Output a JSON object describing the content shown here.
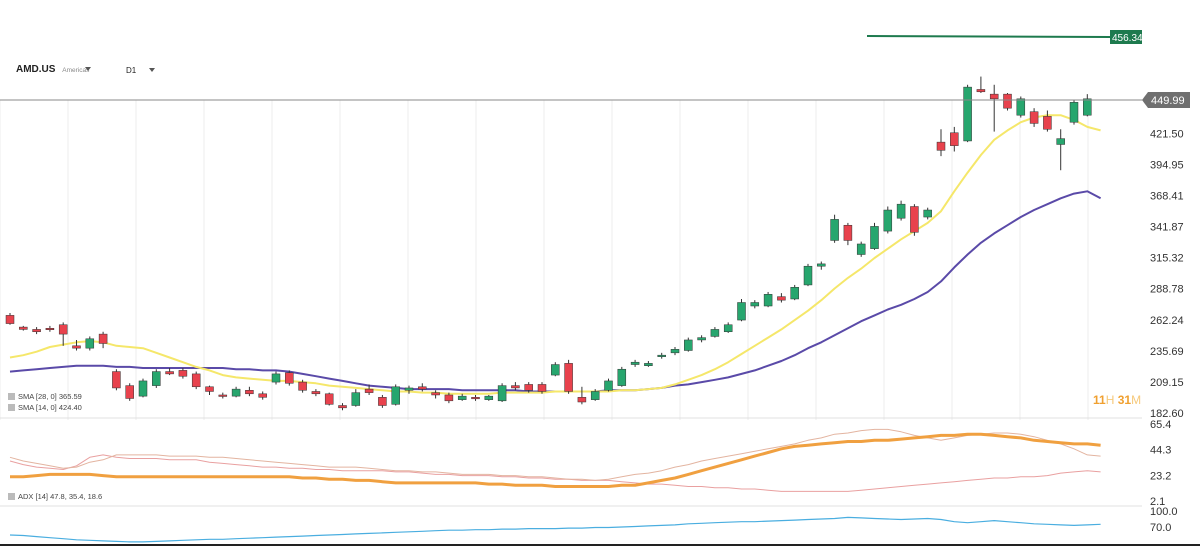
{
  "toolbar": {
    "symbol": "AMD.US",
    "exchange": "Americas",
    "timeframe": "D1"
  },
  "price_tags": {
    "target_label": "456.34",
    "current_label": "449.99"
  },
  "timer": {
    "h": "11",
    "h_unit": "H",
    "m": "31",
    "m_unit": "M"
  },
  "indicators": {
    "sma28_label": "SMA [28, 0] 365.59",
    "sma14_label": "SMA [14, 0] 424.40",
    "adx_label": "ADX [14] 47.8, 35.4, 18.6"
  },
  "colors": {
    "bull": "#27a66e",
    "bear": "#e8424d",
    "sma14": "#f5e76a",
    "sma28": "#5a4aa8",
    "adx": "#f0a040",
    "di_plus": "#e3b4a0",
    "di_minus": "#e9a0a0",
    "osc": "#4aaee0",
    "target_line": "#1e7a4e"
  },
  "chart_data": [
    {
      "type": "candlestick",
      "ticks": [
        "449.99",
        "421.50",
        "394.95",
        "368.41",
        "341.87",
        "315.32",
        "288.78",
        "262.24",
        "235.69",
        "209.15",
        "182.60"
      ],
      "ylim": [
        182.6,
        470.0
      ],
      "target_level": 456.34,
      "current_level": 449.99,
      "candles": [
        {
          "o": 266,
          "h": 268,
          "l": 258,
          "c": 259
        },
        {
          "o": 256,
          "h": 257,
          "l": 253,
          "c": 254
        },
        {
          "o": 254,
          "h": 256,
          "l": 250,
          "c": 252
        },
        {
          "o": 255,
          "h": 257,
          "l": 252,
          "c": 254
        },
        {
          "o": 258,
          "h": 260,
          "l": 240,
          "c": 250
        },
        {
          "o": 240,
          "h": 245,
          "l": 236,
          "c": 238
        },
        {
          "o": 238,
          "h": 248,
          "l": 236,
          "c": 246
        },
        {
          "o": 250,
          "h": 252,
          "l": 238,
          "c": 242
        },
        {
          "o": 218,
          "h": 220,
          "l": 202,
          "c": 204
        },
        {
          "o": 206,
          "h": 208,
          "l": 193,
          "c": 195
        },
        {
          "o": 197,
          "h": 212,
          "l": 196,
          "c": 210
        },
        {
          "o": 206,
          "h": 220,
          "l": 204,
          "c": 218
        },
        {
          "o": 218,
          "h": 221,
          "l": 215,
          "c": 216
        },
        {
          "o": 219,
          "h": 221,
          "l": 212,
          "c": 214
        },
        {
          "o": 216,
          "h": 218,
          "l": 203,
          "c": 205
        },
        {
          "o": 205,
          "h": 206,
          "l": 198,
          "c": 201
        },
        {
          "o": 198,
          "h": 200,
          "l": 195,
          "c": 197
        },
        {
          "o": 197,
          "h": 205,
          "l": 196,
          "c": 203
        },
        {
          "o": 202,
          "h": 205,
          "l": 197,
          "c": 199
        },
        {
          "o": 199,
          "h": 201,
          "l": 194,
          "c": 196
        },
        {
          "o": 209,
          "h": 218,
          "l": 207,
          "c": 216
        },
        {
          "o": 217,
          "h": 219,
          "l": 206,
          "c": 208
        },
        {
          "o": 209,
          "h": 211,
          "l": 200,
          "c": 202
        },
        {
          "o": 201,
          "h": 203,
          "l": 197,
          "c": 199
        },
        {
          "o": 199,
          "h": 200,
          "l": 189,
          "c": 190
        },
        {
          "o": 189,
          "h": 191,
          "l": 185,
          "c": 187
        },
        {
          "o": 189,
          "h": 203,
          "l": 188,
          "c": 200
        },
        {
          "o": 203,
          "h": 207,
          "l": 198,
          "c": 200
        },
        {
          "o": 196,
          "h": 198,
          "l": 187,
          "c": 189
        },
        {
          "o": 190,
          "h": 207,
          "l": 189,
          "c": 205
        },
        {
          "o": 202,
          "h": 206,
          "l": 199,
          "c": 204
        },
        {
          "o": 205,
          "h": 208,
          "l": 201,
          "c": 203
        },
        {
          "o": 200,
          "h": 202,
          "l": 195,
          "c": 198
        },
        {
          "o": 198,
          "h": 200,
          "l": 191,
          "c": 193
        },
        {
          "o": 194,
          "h": 199,
          "l": 193,
          "c": 197
        },
        {
          "o": 196,
          "h": 198,
          "l": 193,
          "c": 195
        },
        {
          "o": 194,
          "h": 198,
          "l": 193,
          "c": 197
        },
        {
          "o": 193,
          "h": 208,
          "l": 192,
          "c": 206
        },
        {
          "o": 206,
          "h": 209,
          "l": 202,
          "c": 204
        },
        {
          "o": 207,
          "h": 209,
          "l": 200,
          "c": 202
        },
        {
          "o": 207,
          "h": 209,
          "l": 199,
          "c": 201
        },
        {
          "o": 215,
          "h": 226,
          "l": 214,
          "c": 224
        },
        {
          "o": 225,
          "h": 228,
          "l": 199,
          "c": 201
        },
        {
          "o": 196,
          "h": 205,
          "l": 190,
          "c": 192
        },
        {
          "o": 194,
          "h": 203,
          "l": 193,
          "c": 201
        },
        {
          "o": 202,
          "h": 212,
          "l": 201,
          "c": 210
        },
        {
          "o": 206,
          "h": 222,
          "l": 205,
          "c": 220
        },
        {
          "o": 224,
          "h": 228,
          "l": 222,
          "c": 226
        },
        {
          "o": 223,
          "h": 227,
          "l": 222,
          "c": 225
        },
        {
          "o": 231,
          "h": 234,
          "l": 229,
          "c": 232
        },
        {
          "o": 234,
          "h": 239,
          "l": 232,
          "c": 237
        },
        {
          "o": 236,
          "h": 247,
          "l": 235,
          "c": 245
        },
        {
          "o": 245,
          "h": 249,
          "l": 243,
          "c": 247
        },
        {
          "o": 248,
          "h": 256,
          "l": 247,
          "c": 254
        },
        {
          "o": 252,
          "h": 260,
          "l": 251,
          "c": 258
        },
        {
          "o": 262,
          "h": 280,
          "l": 261,
          "c": 277
        },
        {
          "o": 274,
          "h": 279,
          "l": 272,
          "c": 277
        },
        {
          "o": 274,
          "h": 286,
          "l": 273,
          "c": 284
        },
        {
          "o": 282,
          "h": 285,
          "l": 277,
          "c": 279
        },
        {
          "o": 280,
          "h": 292,
          "l": 279,
          "c": 290
        },
        {
          "o": 292,
          "h": 310,
          "l": 291,
          "c": 308
        },
        {
          "o": 308,
          "h": 312,
          "l": 305,
          "c": 310
        },
        {
          "o": 330,
          "h": 352,
          "l": 328,
          "c": 348
        },
        {
          "o": 343,
          "h": 345,
          "l": 326,
          "c": 330
        },
        {
          "o": 318,
          "h": 329,
          "l": 316,
          "c": 327
        },
        {
          "o": 323,
          "h": 345,
          "l": 322,
          "c": 342
        },
        {
          "o": 338,
          "h": 359,
          "l": 336,
          "c": 356
        },
        {
          "o": 349,
          "h": 364,
          "l": 347,
          "c": 361
        },
        {
          "o": 359,
          "h": 361,
          "l": 334,
          "c": 337
        },
        {
          "o": 350,
          "h": 358,
          "l": 348,
          "c": 356
        },
        {
          "o": 414,
          "h": 425,
          "l": 402,
          "c": 407
        },
        {
          "o": 422,
          "h": 427,
          "l": 406,
          "c": 411
        },
        {
          "o": 415,
          "h": 463,
          "l": 414,
          "c": 461
        },
        {
          "o": 459,
          "h": 470,
          "l": 456,
          "c": 457
        },
        {
          "o": 455,
          "h": 463,
          "l": 423,
          "c": 451
        },
        {
          "o": 455,
          "h": 456,
          "l": 441,
          "c": 443
        },
        {
          "o": 437,
          "h": 453,
          "l": 435,
          "c": 451
        },
        {
          "o": 440,
          "h": 443,
          "l": 427,
          "c": 430
        },
        {
          "o": 436,
          "h": 441,
          "l": 423,
          "c": 425
        },
        {
          "o": 412,
          "h": 425,
          "l": 390,
          "c": 417
        },
        {
          "o": 431,
          "h": 450,
          "l": 429,
          "c": 448
        },
        {
          "o": 437,
          "h": 455,
          "l": 436,
          "c": 451
        }
      ],
      "sma14": [
        230,
        232,
        235,
        239,
        241,
        243,
        244,
        243,
        240,
        239,
        238,
        234,
        230,
        226,
        222,
        219,
        215,
        213,
        212,
        211,
        210,
        210,
        209,
        208,
        206,
        205,
        204,
        203,
        202,
        201,
        201,
        200,
        200,
        199,
        199,
        199,
        199,
        200,
        200,
        200,
        200,
        201,
        201,
        201,
        201,
        201,
        202,
        202,
        203,
        204,
        207,
        211,
        215,
        220,
        226,
        233,
        240,
        247,
        254,
        262,
        270,
        279,
        289,
        298,
        306,
        315,
        323,
        331,
        338,
        345,
        355,
        372,
        388,
        403,
        416,
        424,
        431,
        435,
        437,
        437,
        433,
        427,
        424
      ],
      "sma28": [
        218,
        219,
        220,
        221,
        222,
        223,
        223,
        223,
        222,
        222,
        221,
        221,
        221,
        221,
        221,
        221,
        221,
        220,
        220,
        219,
        219,
        218,
        216,
        214,
        212,
        210,
        208,
        206,
        205,
        204,
        203,
        203,
        203,
        203,
        202,
        202,
        202,
        202,
        202,
        201,
        201,
        201,
        201,
        201,
        201,
        202,
        202,
        202,
        203,
        204,
        206,
        207,
        209,
        211,
        213,
        216,
        219,
        223,
        227,
        232,
        238,
        243,
        249,
        255,
        261,
        266,
        271,
        275,
        280,
        286,
        295,
        307,
        318,
        328,
        336,
        343,
        350,
        356,
        361,
        366,
        370,
        372,
        366
      ]
    },
    {
      "type": "line",
      "title": "ADX",
      "ticks": [
        "65.4",
        "44.3",
        "23.2",
        "2.1"
      ],
      "ylim": [
        2.1,
        65.4
      ],
      "series": [
        {
          "values": [
            22,
            22,
            23,
            24,
            24,
            24,
            24,
            23,
            22,
            22,
            22,
            22,
            22,
            22,
            22,
            22,
            22,
            22,
            22,
            22,
            22,
            22,
            21,
            21,
            20,
            20,
            19,
            19,
            18,
            17,
            17,
            17,
            17,
            17,
            17,
            17,
            16,
            16,
            15,
            15,
            15,
            14,
            14,
            14,
            14,
            14,
            15,
            15,
            17,
            19,
            21,
            24,
            27,
            30,
            33,
            36,
            39,
            42,
            45,
            47,
            48,
            49,
            50,
            51,
            51,
            52,
            52,
            53,
            54,
            55,
            56,
            56,
            57,
            57,
            56,
            55,
            54,
            52,
            51,
            50,
            49,
            49,
            48
          ]
        },
        {
          "values": [
            38,
            35,
            33,
            31,
            29,
            30,
            34,
            36,
            40,
            40,
            40,
            40,
            39,
            39,
            39,
            38,
            38,
            37,
            36,
            35,
            34,
            33,
            32,
            31,
            30,
            30,
            30,
            29,
            28,
            27,
            27,
            26,
            26,
            25,
            24,
            24,
            24,
            23,
            23,
            22,
            22,
            21,
            20,
            20,
            19,
            20,
            22,
            24,
            25,
            27,
            30,
            32,
            35,
            37,
            39,
            41,
            43,
            45,
            47,
            49,
            52,
            54,
            57,
            58,
            60,
            61,
            61,
            59,
            56,
            54,
            52,
            54,
            56,
            57,
            58,
            58,
            57,
            55,
            52,
            49,
            45,
            40,
            39
          ]
        },
        {
          "values": [
            35,
            32,
            30,
            29,
            28,
            31,
            38,
            40,
            38,
            37,
            37,
            37,
            36,
            36,
            36,
            34,
            33,
            32,
            31,
            30,
            30,
            29,
            29,
            28,
            28,
            27,
            27,
            27,
            27,
            26,
            26,
            25,
            24,
            24,
            23,
            23,
            23,
            22,
            22,
            21,
            21,
            20,
            20,
            19,
            19,
            19,
            18,
            17,
            16,
            16,
            15,
            14,
            14,
            13,
            13,
            12,
            12,
            11,
            10,
            10,
            10,
            10,
            10,
            10,
            11,
            12,
            13,
            14,
            15,
            16,
            17,
            18,
            19,
            20,
            21,
            21,
            22,
            22,
            23,
            25,
            26,
            27,
            26
          ]
        }
      ]
    },
    {
      "type": "line",
      "ticks": [
        "100.0",
        "70.0"
      ],
      "ylim": [
        40,
        100
      ],
      "series": [
        {
          "values": [
            55,
            54,
            52,
            50,
            48,
            46,
            45,
            44,
            43,
            42,
            42,
            43,
            44,
            45,
            46,
            47,
            47,
            48,
            49,
            50,
            51,
            52,
            53,
            54,
            55,
            56,
            57,
            58,
            59,
            60,
            61,
            62,
            63,
            64,
            64,
            65,
            65,
            66,
            66,
            67,
            67,
            67,
            68,
            68,
            69,
            69,
            70,
            71,
            72,
            73,
            74,
            76,
            77,
            78,
            79,
            80,
            80,
            81,
            82,
            83,
            84,
            85,
            86,
            88,
            87,
            86,
            85,
            84,
            85,
            86,
            84,
            80,
            78,
            80,
            82,
            80,
            78,
            76,
            75,
            74,
            73,
            74,
            75
          ]
        }
      ]
    }
  ]
}
